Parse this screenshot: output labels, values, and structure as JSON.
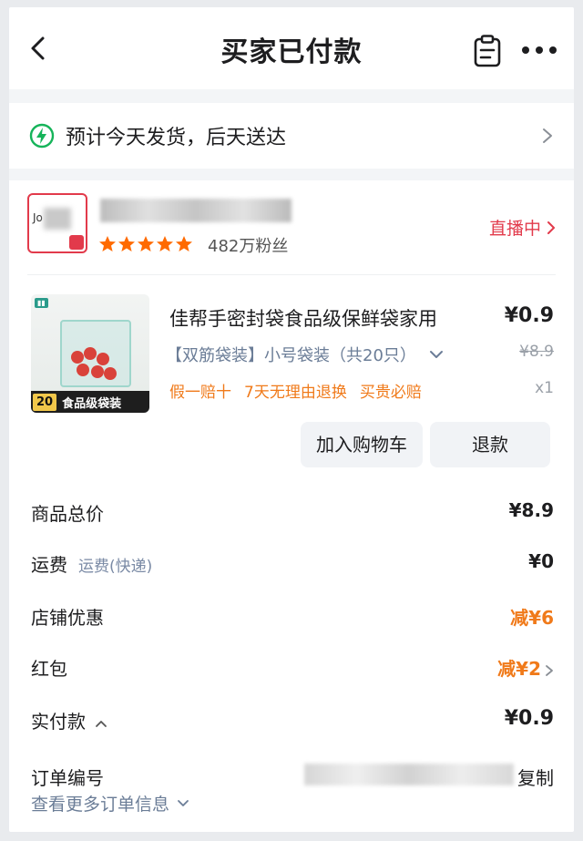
{
  "header": {
    "title": "买家已付款"
  },
  "shipping": {
    "text": "预计今天发货，后天送达"
  },
  "shop": {
    "logo_text": "Jo",
    "fans": "482万粉丝",
    "live_label": "直播中"
  },
  "product": {
    "name": "佳帮手密封袋食品级保鲜袋家用",
    "price": "¥0.9",
    "spec": "【双筋袋装】小号袋装（共20只）",
    "old_price": "¥8.9",
    "promos": [
      "假一赔十",
      "7天无理由退换",
      "买贵必赔"
    ],
    "quantity": "x1",
    "image_tag": "20",
    "image_caption": "食品级袋装"
  },
  "actions": {
    "add_to_cart": "加入购物车",
    "refund": "退款"
  },
  "summary": {
    "total_label": "商品总价",
    "total_value": "¥8.9",
    "shipping_label": "运费",
    "shipping_sub": "运费(快递)",
    "shipping_value": "¥0",
    "shop_discount_label": "店铺优惠",
    "shop_discount_value": "减¥6",
    "redpacket_label": "红包",
    "redpacket_value": "减¥2",
    "paid_label": "实付款",
    "paid_value": "¥0.9"
  },
  "order": {
    "number_label": "订单编号",
    "copy_label": "复制",
    "more_label": "查看更多订单信息"
  },
  "colors": {
    "accent_red": "#e23a4b",
    "promo_orange": "#f07a1a",
    "star_orange": "#ff6a00",
    "bolt_green": "#16b45a"
  }
}
